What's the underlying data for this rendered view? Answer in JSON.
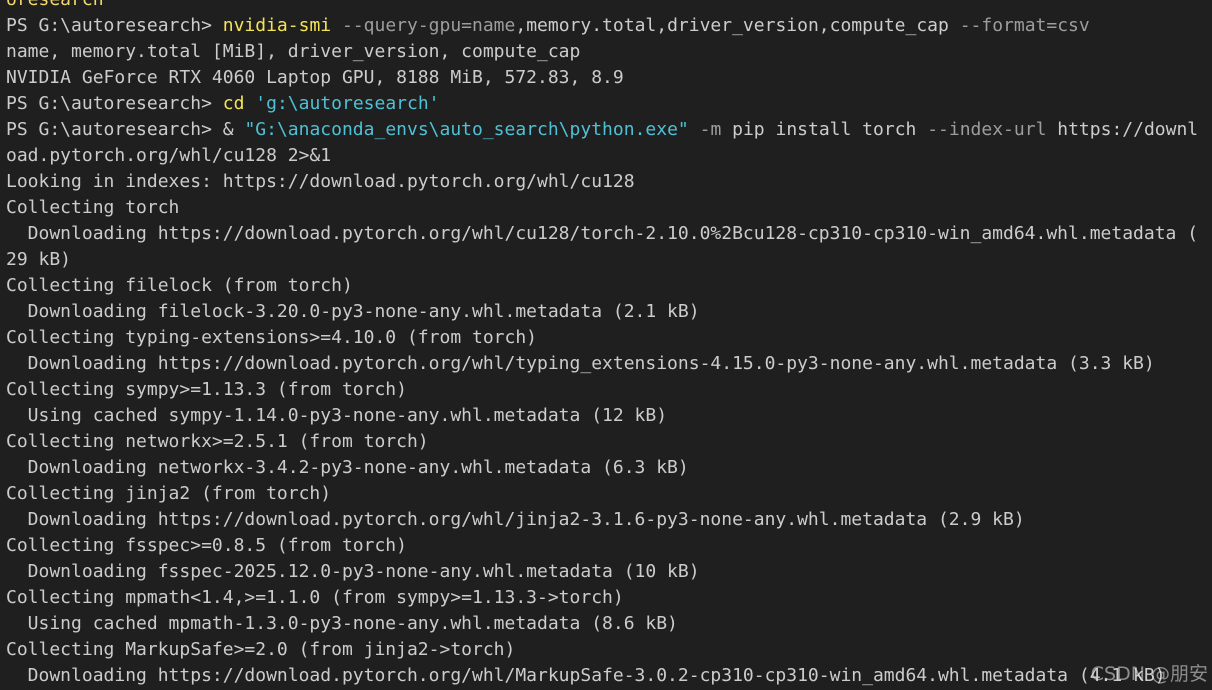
{
  "terminal": {
    "background": "#1f1f1f",
    "colors": {
      "text": "#cccccc",
      "command": "#f5e356",
      "parameter": "#9d9d9d",
      "string": "#4fc1d6"
    },
    "top_partial": "oresearch",
    "lines": [
      {
        "segments": [
          {
            "t": "PS G:\\autoresearch> ",
            "c": "plain"
          },
          {
            "t": "nvidia-smi",
            "c": "cmd"
          },
          {
            "t": " ",
            "c": "plain"
          },
          {
            "t": "--query-gpu=name",
            "c": "param"
          },
          {
            "t": ",memory.total,driver_version,compute_cap",
            "c": "plain"
          },
          {
            "t": " ",
            "c": "plain"
          },
          {
            "t": "--format=csv",
            "c": "param"
          }
        ]
      },
      {
        "segments": [
          {
            "t": "name, memory.total [MiB], driver_version, compute_cap",
            "c": "plain"
          }
        ]
      },
      {
        "segments": [
          {
            "t": "NVIDIA GeForce RTX 4060 Laptop GPU, 8188 MiB, 572.83, 8.9",
            "c": "plain"
          }
        ]
      },
      {
        "segments": [
          {
            "t": "PS G:\\autoresearch> ",
            "c": "plain"
          },
          {
            "t": "cd",
            "c": "cmd"
          },
          {
            "t": " ",
            "c": "plain"
          },
          {
            "t": "'g:\\autoresearch'",
            "c": "str"
          }
        ]
      },
      {
        "segments": [
          {
            "t": "PS G:\\autoresearch> ",
            "c": "plain"
          },
          {
            "t": "& ",
            "c": "plain"
          },
          {
            "t": "\"G:\\anaconda_envs\\auto_search\\python.exe\"",
            "c": "str"
          },
          {
            "t": " ",
            "c": "plain"
          },
          {
            "t": "-m",
            "c": "param"
          },
          {
            "t": " pip install torch ",
            "c": "plain"
          },
          {
            "t": "--index-url",
            "c": "param"
          },
          {
            "t": " https://downl",
            "c": "plain"
          }
        ]
      },
      {
        "segments": [
          {
            "t": "oad.pytorch.org/whl/cu128 2>&1",
            "c": "plain"
          }
        ]
      },
      {
        "segments": [
          {
            "t": "Looking in indexes: https://download.pytorch.org/whl/cu128",
            "c": "plain"
          }
        ]
      },
      {
        "segments": [
          {
            "t": "Collecting torch",
            "c": "plain"
          }
        ]
      },
      {
        "segments": [
          {
            "t": "  Downloading https://download.pytorch.org/whl/cu128/torch-2.10.0%2Bcu128-cp310-cp310-win_amd64.whl.metadata (",
            "c": "plain"
          }
        ]
      },
      {
        "segments": [
          {
            "t": "29 kB)",
            "c": "plain"
          }
        ]
      },
      {
        "segments": [
          {
            "t": "Collecting filelock (from torch)",
            "c": "plain"
          }
        ]
      },
      {
        "segments": [
          {
            "t": "  Downloading filelock-3.20.0-py3-none-any.whl.metadata (2.1 kB)",
            "c": "plain"
          }
        ]
      },
      {
        "segments": [
          {
            "t": "Collecting typing-extensions>=4.10.0 (from torch)",
            "c": "plain"
          }
        ]
      },
      {
        "segments": [
          {
            "t": "  Downloading https://download.pytorch.org/whl/typing_extensions-4.15.0-py3-none-any.whl.metadata (3.3 kB)",
            "c": "plain"
          }
        ]
      },
      {
        "segments": [
          {
            "t": "Collecting sympy>=1.13.3 (from torch)",
            "c": "plain"
          }
        ]
      },
      {
        "segments": [
          {
            "t": "  Using cached sympy-1.14.0-py3-none-any.whl.metadata (12 kB)",
            "c": "plain"
          }
        ]
      },
      {
        "segments": [
          {
            "t": "Collecting networkx>=2.5.1 (from torch)",
            "c": "plain"
          }
        ]
      },
      {
        "segments": [
          {
            "t": "  Downloading networkx-3.4.2-py3-none-any.whl.metadata (6.3 kB)",
            "c": "plain"
          }
        ]
      },
      {
        "segments": [
          {
            "t": "Collecting jinja2 (from torch)",
            "c": "plain"
          }
        ]
      },
      {
        "segments": [
          {
            "t": "  Downloading https://download.pytorch.org/whl/jinja2-3.1.6-py3-none-any.whl.metadata (2.9 kB)",
            "c": "plain"
          }
        ]
      },
      {
        "segments": [
          {
            "t": "Collecting fsspec>=0.8.5 (from torch)",
            "c": "plain"
          }
        ]
      },
      {
        "segments": [
          {
            "t": "  Downloading fsspec-2025.12.0-py3-none-any.whl.metadata (10 kB)",
            "c": "plain"
          }
        ]
      },
      {
        "segments": [
          {
            "t": "Collecting mpmath<1.4,>=1.1.0 (from sympy>=1.13.3->torch)",
            "c": "plain"
          }
        ]
      },
      {
        "segments": [
          {
            "t": "  Using cached mpmath-1.3.0-py3-none-any.whl.metadata (8.6 kB)",
            "c": "plain"
          }
        ]
      },
      {
        "segments": [
          {
            "t": "Collecting MarkupSafe>=2.0 (from jinja2->torch)",
            "c": "plain"
          }
        ]
      },
      {
        "segments": [
          {
            "t": "  Downloading https://download.pytorch.org/whl/MarkupSafe-3.0.2-cp310-cp310-win_amd64.whl.metadata (4.1 kB)",
            "c": "plain"
          }
        ]
      }
    ]
  },
  "watermark": "CSDN @朋安"
}
